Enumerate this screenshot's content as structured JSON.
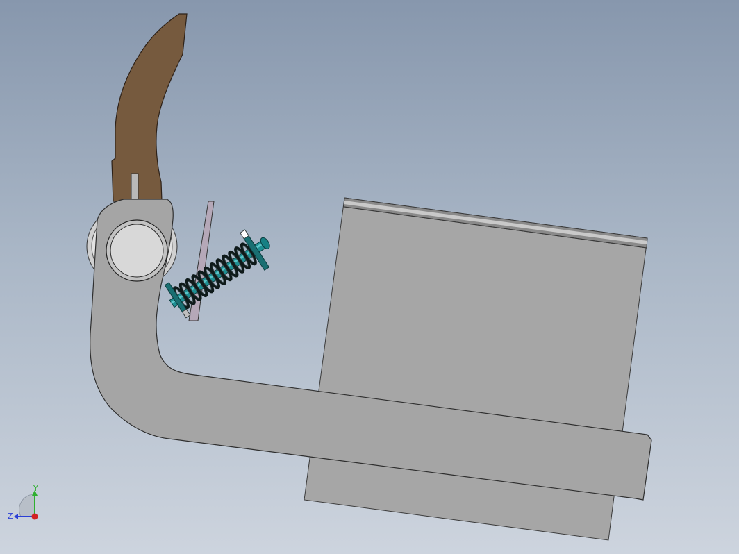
{
  "viewport": {
    "name": "solidworks-graphics-area",
    "background_top": "#8797ad",
    "background_bottom": "#cdd4de"
  },
  "model": {
    "parts": [
      {
        "id": "lever-arm",
        "color": "#a5a5a5"
      },
      {
        "id": "handle-grip",
        "color": "#765a3e"
      },
      {
        "id": "pivot-pin",
        "color": "#c8c8c8"
      },
      {
        "id": "spring",
        "color": "#0f1a1a"
      },
      {
        "id": "spring-rod",
        "color": "#1f8f93"
      },
      {
        "id": "housing-block",
        "color": "#a6a6a6"
      },
      {
        "id": "bracket-plate",
        "color": "#b5a8b8"
      }
    ]
  },
  "triad": {
    "labels": {
      "y": "Y",
      "z": "Z"
    },
    "colors": {
      "y": "#2fb02f",
      "z": "#2b3fd6",
      "x": "#d22222"
    }
  }
}
